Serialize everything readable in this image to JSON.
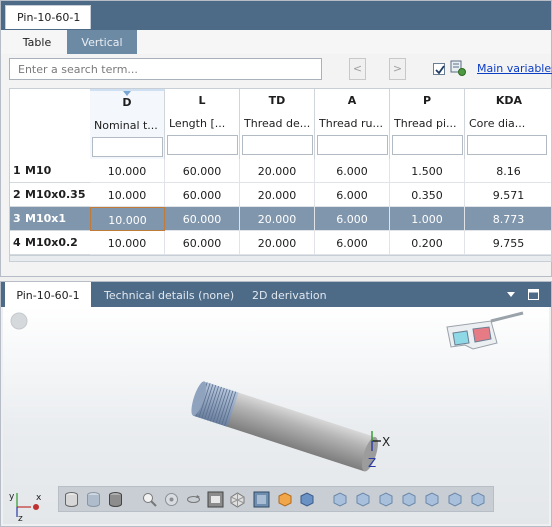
{
  "window": {
    "title": "Pin-10-60-1"
  },
  "view_tabs": [
    {
      "label": "Table"
    },
    {
      "label": "Vertical"
    }
  ],
  "search": {
    "placeholder": "Enter a search term..."
  },
  "nav": {
    "prev": "<",
    "next": ">"
  },
  "main_variables": {
    "label": "Main variables",
    "checked": true
  },
  "table": {
    "columns": [
      {
        "code": "D",
        "desc": "Nominal t..."
      },
      {
        "code": "L",
        "desc": "Length [..."
      },
      {
        "code": "TD",
        "desc": "Thread de..."
      },
      {
        "code": "A",
        "desc": "Thread ru..."
      },
      {
        "code": "P",
        "desc": "Thread pi..."
      },
      {
        "code": "KDA",
        "desc": "Core dia..."
      }
    ],
    "rows": [
      {
        "num": "1",
        "name": "M10",
        "cells": [
          "10.000",
          "60.000",
          "20.000",
          "6.000",
          "1.500",
          "8.16"
        ]
      },
      {
        "num": "2",
        "name": "M10x0.35",
        "cells": [
          "10.000",
          "60.000",
          "20.000",
          "6.000",
          "0.350",
          "9.571"
        ]
      },
      {
        "num": "3",
        "name": "M10x1",
        "cells": [
          "10.000",
          "60.000",
          "20.000",
          "6.000",
          "1.000",
          "8.773"
        ],
        "selected": true
      },
      {
        "num": "4",
        "name": "M10x0.2",
        "cells": [
          "10.000",
          "60.000",
          "20.000",
          "6.000",
          "0.200",
          "9.755"
        ]
      }
    ]
  },
  "bottom_tabs": [
    {
      "label": "Pin-10-60-1"
    },
    {
      "label": "Technical details (none)"
    },
    {
      "label": "2D derivation"
    }
  ],
  "viewer": {
    "axis_label_x": "X",
    "axis_label_z": "Z",
    "triad_y": "y",
    "triad_x": "x",
    "triad_z": "z"
  },
  "colors": {
    "accent": "#4d6a87",
    "selection": "#8096ad",
    "link": "#0b3cc4"
  }
}
